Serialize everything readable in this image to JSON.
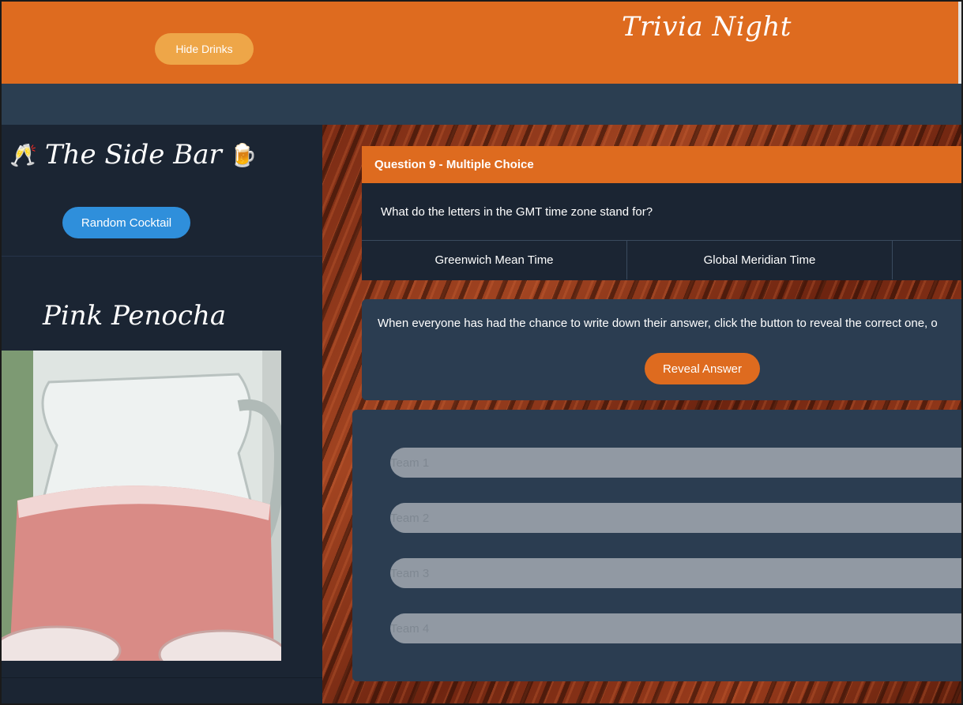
{
  "header": {
    "hide_drinks_label": "Hide Drinks",
    "title": "Trivia Night"
  },
  "sidebar": {
    "title": "The Side Bar",
    "title_icon_left": "🥂",
    "title_icon_right": "🍺",
    "random_cocktail_label": "Random Cocktail",
    "drink_name": "Pink Penocha",
    "drink_photo_alt": "pitcher of pink drink"
  },
  "question": {
    "header": "Question 9 - Multiple Choice",
    "text": "What do the letters in the GMT time zone stand for?",
    "options": [
      "Greenwich Mean Time",
      "Global Meridian Time",
      ""
    ]
  },
  "reveal": {
    "instructions": "When everyone has had the chance to write down their answer, click the button to reveal the correct one, o",
    "button_label": "Reveal Answer"
  },
  "teams": {
    "placeholders": [
      "Team 1",
      "Team 2",
      "Team 3",
      "Team 4"
    ]
  },
  "colors": {
    "header_orange": "#de6b1f",
    "hide_button": "#eea648",
    "random_button": "#2f8fdb",
    "nav_band": "#2b3e51",
    "sidebar_bg": "#1b2533",
    "card_bg": "#2b3d51",
    "team_input": "#9199a3"
  }
}
